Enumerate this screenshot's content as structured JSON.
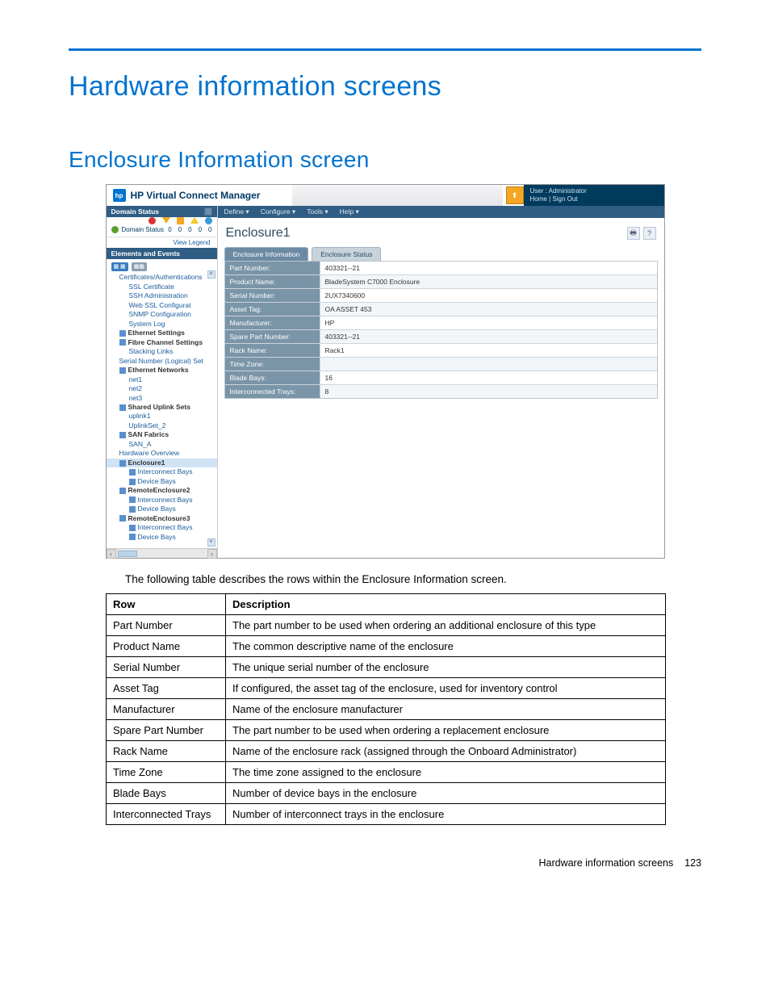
{
  "doc": {
    "h1": "Hardware information screens",
    "h2": "Enclosure Information screen",
    "lead": "The following table describes the rows within the Enclosure Information screen.",
    "footer_label": "Hardware information screens",
    "page_no": "123"
  },
  "app": {
    "product": "HP Virtual Connect Manager",
    "user_label": "User : Administrator",
    "home": "Home",
    "signout": "Sign Out",
    "menubar": [
      "Define ▾",
      "Configure ▾",
      "Tools ▾",
      "Help ▾"
    ],
    "page_title": "Enclosure1",
    "tabs": {
      "active": "Enclosure Information",
      "other": "Enclosure Status"
    },
    "info_rows": [
      {
        "k": "Part Number:",
        "v": "403321--21"
      },
      {
        "k": "Product Name:",
        "v": "BladeSystem C7000 Enclosure"
      },
      {
        "k": "Serial Number:",
        "v": "2UX7340600"
      },
      {
        "k": "Asset Tag:",
        "v": "OA ASSET 453"
      },
      {
        "k": "Manufacturer:",
        "v": "HP"
      },
      {
        "k": "Spare Part Number:",
        "v": "403321--21"
      },
      {
        "k": "Rack Name:",
        "v": "Rack1"
      },
      {
        "k": "Time Zone:",
        "v": ""
      },
      {
        "k": "Blade Bays:",
        "v": "16"
      },
      {
        "k": "Interconnected Trays:",
        "v": "8"
      }
    ]
  },
  "sidebar": {
    "head1": "Domain Status",
    "domain_label": "Domain Status",
    "nums": [
      "0",
      "0",
      "0",
      "0",
      "0"
    ],
    "legend": "View Legend",
    "head2": "Elements and Events",
    "tree": [
      {
        "t": "Certificates/Authentications",
        "l": 1,
        "dark": 0
      },
      {
        "t": "SSL Certificate",
        "l": 2
      },
      {
        "t": "SSH Administration",
        "l": 2
      },
      {
        "t": "",
        "l": 2
      },
      {
        "t": "Web SSL Configurat",
        "l": 2
      },
      {
        "t": "SNMP Configuration",
        "l": 2
      },
      {
        "t": "System Log",
        "l": 2
      },
      {
        "t": "Ethernet Settings",
        "l": 1,
        "ico": 1,
        "dark": 1
      },
      {
        "t": "Fibre Channel Settings",
        "l": 1,
        "ico": 1,
        "dark": 1
      },
      {
        "t": "Stacking Links",
        "l": 2
      },
      {
        "t": "",
        "l": 2
      },
      {
        "t": "Serial Number (Logical) Set",
        "l": 1
      },
      {
        "t": "",
        "l": 1
      },
      {
        "t": "Ethernet Networks",
        "l": 1,
        "ico": 1,
        "dark": 1
      },
      {
        "t": "net1",
        "l": 2
      },
      {
        "t": "net2",
        "l": 2
      },
      {
        "t": "net3",
        "l": 2
      },
      {
        "t": "Shared Uplink Sets",
        "l": 1,
        "ico": 1,
        "dark": 1
      },
      {
        "t": "uplink1",
        "l": 2
      },
      {
        "t": "UplinkSet_2",
        "l": 2
      },
      {
        "t": "SAN Fabrics",
        "l": 1,
        "ico": 1,
        "dark": 1
      },
      {
        "t": "SAN_A",
        "l": 2
      },
      {
        "t": "",
        "l": 2
      },
      {
        "t": "Hardware Overview",
        "l": 1
      },
      {
        "t": "Enclosure1",
        "l": 1,
        "ico": 1,
        "sel": 1,
        "dark": 1
      },
      {
        "t": "Interconnect Bays",
        "l": 2,
        "ico": 1
      },
      {
        "t": "Device Bays",
        "l": 2,
        "ico": 1
      },
      {
        "t": "RemoteEnclosure2",
        "l": 1,
        "ico": 1,
        "dark": 1
      },
      {
        "t": "Interconnect Bays",
        "l": 2,
        "ico": 1
      },
      {
        "t": "Device Bays",
        "l": 2,
        "ico": 1
      },
      {
        "t": "RemoteEnclosure3",
        "l": 1,
        "ico": 1,
        "dark": 1
      },
      {
        "t": "Interconnect Bays",
        "l": 2,
        "ico": 1
      },
      {
        "t": "Device Bays",
        "l": 2,
        "ico": 1
      }
    ]
  },
  "table": {
    "head": {
      "c1": "Row",
      "c2": "Description"
    },
    "rows": [
      {
        "r": "Part Number",
        "d": "The part number to be used when ordering an additional enclosure of this type"
      },
      {
        "r": "Product Name",
        "d": "The common descriptive name of the enclosure"
      },
      {
        "r": "Serial Number",
        "d": "The unique serial number of the enclosure"
      },
      {
        "r": "Asset Tag",
        "d": "If configured, the asset tag of the enclosure, used for inventory control"
      },
      {
        "r": "Manufacturer",
        "d": "Name of the enclosure manufacturer"
      },
      {
        "r": "Spare Part Number",
        "d": "The part number to be used when ordering a replacement enclosure"
      },
      {
        "r": "Rack Name",
        "d": "Name of the enclosure rack (assigned through the Onboard Administrator)"
      },
      {
        "r": "Time Zone",
        "d": "The time zone assigned to the enclosure"
      },
      {
        "r": "Blade Bays",
        "d": "Number of device bays in the enclosure"
      },
      {
        "r": "Interconnected Trays",
        "d": "Number of interconnect trays in the enclosure"
      }
    ]
  }
}
